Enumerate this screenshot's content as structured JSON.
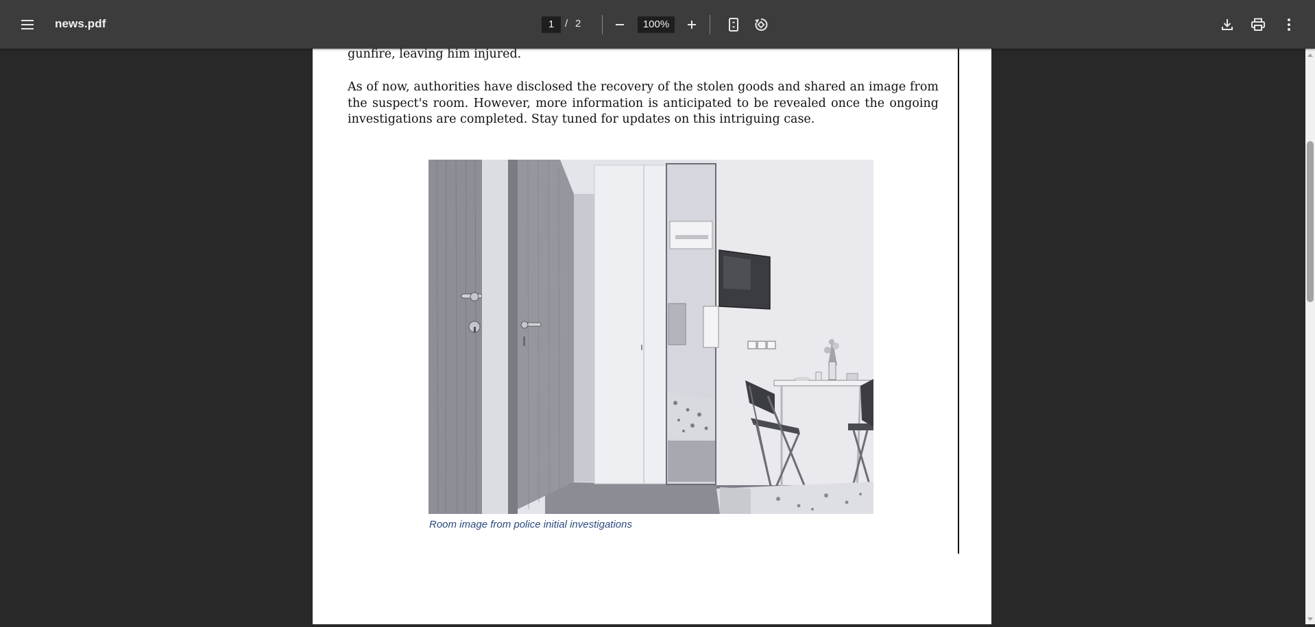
{
  "toolbar": {
    "menu_icon": "hamburger-menu-icon",
    "file_name": "news.pdf",
    "current_page": "1",
    "page_separator": "/",
    "total_pages": "2",
    "zoom_out_icon": "minus-icon",
    "zoom_level": "100%",
    "zoom_in_icon": "plus-icon",
    "fit_page_icon": "fit-to-page-icon",
    "rotate_icon": "rotate-counterclockwise-icon",
    "download_icon": "download-icon",
    "print_icon": "print-icon",
    "more_icon": "more-vertical-icon"
  },
  "document": {
    "paragraph_1": "gunfire, leaving him injured.",
    "paragraph_2": "As of now, authorities have disclosed the recovery of the stolen goods and shared an image from the suspect's room. However, more information is anticipated to be revealed once the ongoing investigations are completed. Stay tuned for updates on this intriguing case.",
    "image_caption": "Room image from police initial investigations"
  },
  "colors": {
    "toolbar_bg": "#3c3c3c",
    "viewer_bg": "#282828",
    "caption_color": "#2b4a7c"
  }
}
